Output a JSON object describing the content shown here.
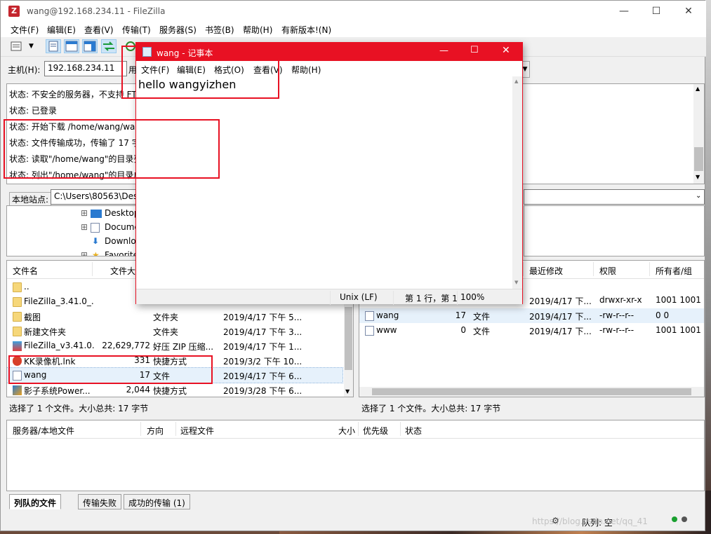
{
  "window": {
    "title": "wang@192.168.234.11 - FileZilla",
    "controls": {
      "minimize": "—",
      "maximize": "☐",
      "close": "✕"
    }
  },
  "menu": [
    "文件(F)",
    "编辑(E)",
    "查看(V)",
    "传输(T)",
    "服务器(S)",
    "书签(B)",
    "帮助(H)",
    "有新版本!(N)"
  ],
  "quickconnect": {
    "host_label": "主机(H):",
    "host_value": "192.168.234.11"
  },
  "log": {
    "lines": [
      "状态: 不安全的服务器，不支持 FTP",
      "状态: 已登录",
      "状态: 开始下载 /home/wang/wan",
      "状态: 文件传输成功，传输了 17 字",
      "状态: 读取\"/home/wang\"的目录列",
      "状态: 列出\"/home/wang\"的目录成"
    ]
  },
  "local": {
    "site_label": "本地站点:",
    "site_path": "C:\\Users\\80563\\Des",
    "tree": [
      "Desktop",
      "Docume",
      "Downlo",
      "Favorite"
    ],
    "headers": [
      "文件名",
      "文件大"
    ],
    "files": [
      {
        "name": "..",
        "size": "",
        "type": "",
        "modified": "",
        "icon": "folder-icon"
      },
      {
        "name": "FileZilla_3.41.0_...",
        "size": "",
        "type": "",
        "modified": "",
        "icon": "folder-icon"
      },
      {
        "name": "截图",
        "size": "",
        "type": "文件夹",
        "modified": "2019/4/17 下午 5...",
        "icon": "folder-icon"
      },
      {
        "name": "新建文件夹",
        "size": "",
        "type": "文件夹",
        "modified": "2019/4/17 下午 3...",
        "icon": "folder-icon"
      },
      {
        "name": "FileZilla_v3.41.0...",
        "size": "22,629,772",
        "type": "好压 ZIP 压缩...",
        "modified": "2019/4/17 下午 1...",
        "icon": "archive-icon"
      },
      {
        "name": "KK录像机.lnk",
        "size": "331",
        "type": "快捷方式",
        "modified": "2019/3/2 下午 10...",
        "icon": "kk-recorder-icon"
      },
      {
        "name": "wang",
        "size": "17",
        "type": "文件",
        "modified": "2019/4/17 下午 6...",
        "icon": "file-icon"
      },
      {
        "name": "影子系统Power...",
        "size": "2,044",
        "type": "快捷方式",
        "modified": "2019/3/28 下午 6...",
        "icon": "shortcut-icon"
      }
    ],
    "status": "选择了 1 个文件。大小总共: 17 字节"
  },
  "remote": {
    "headers": [
      "最近修改",
      "权限",
      "所有者/组"
    ],
    "files": [
      {
        "name": "",
        "size": "",
        "type": "",
        "modified": "2019/4/17 下...",
        "perm": "drwxr-xr-x",
        "owner": "1001 1001"
      },
      {
        "name": "wang",
        "size": "17",
        "type": "文件",
        "modified": "2019/4/17 下...",
        "perm": "-rw-r--r--",
        "owner": "0 0"
      },
      {
        "name": "www",
        "size": "0",
        "type": "文件",
        "modified": "2019/4/17 下...",
        "perm": "-rw-r--r--",
        "owner": "1001 1001"
      }
    ],
    "status": "选择了 1 个文件。大小总共: 17 字节"
  },
  "queue": {
    "headers": [
      "服务器/本地文件",
      "方向",
      "远程文件",
      "大小",
      "优先级",
      "状态"
    ],
    "tabs": [
      "列队的文件",
      "传输失败",
      "成功的传输 (1)"
    ],
    "footer": "队列: 空"
  },
  "notepad": {
    "title": "wang - 记事本",
    "menu": [
      "文件(F)",
      "编辑(E)",
      "格式(O)",
      "查看(V)",
      "帮助(H)"
    ],
    "content": "hello wangyizhen",
    "status_encoding": "Unix (LF)",
    "status_position": "第 1 行，第 1",
    "status_zoom": "100%",
    "behind_label": "用"
  },
  "watermark": "https://blog.csdn.net/qq_41",
  "colors": {
    "accent_red": "#e81123",
    "selection": "#cce8ff",
    "log_bg": "#ffffff"
  }
}
